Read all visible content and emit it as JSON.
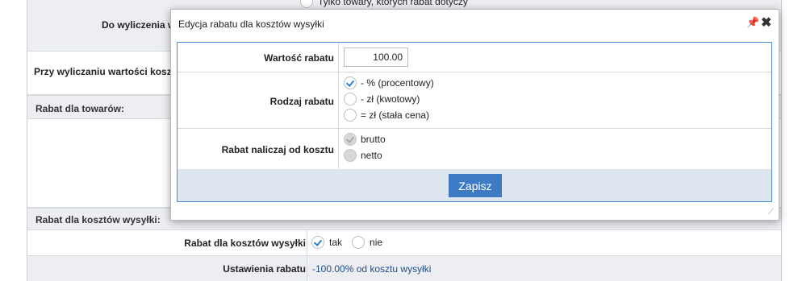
{
  "background": {
    "top_option": "Tylko towary, których rabat dotyczy",
    "row_do_wyliczenia": "Do wyliczenia w",
    "row_przy_wyliczaniu": "Przy wyliczaniu wartości kosz",
    "section_towary": "Rabat dla towarów:",
    "section_koszty": "Rabat dla kosztów wysyłki:",
    "rabat_koszty_label": "Rabat dla kosztów wysyłki",
    "rabat_koszty_tak": "tak",
    "rabat_koszty_nie": "nie",
    "ustawienia_label": "Ustawienia rabatu",
    "ustawienia_value": "-100.00% od kosztu wysyłki"
  },
  "dialog": {
    "title": "Edycja rabatu dla kosztów wysyłki",
    "wartosc_label": "Wartość rabatu",
    "wartosc_value": "100.00",
    "rodzaj_label": "Rodzaj rabatu",
    "rodzaj_options": [
      "- % (procentowy)",
      "- zł (kwotowy)",
      "= zł (stała cena)"
    ],
    "rodzaj_selected": 0,
    "naliczaj_label": "Rabat naliczaj od kosztu",
    "naliczaj_options": [
      "brutto",
      "netto"
    ],
    "naliczaj_selected": 0,
    "save_label": "Zapisz"
  },
  "icons": {
    "pin": "pin-icon",
    "close": "close-icon",
    "resize": "resize-grip-icon"
  },
  "colors": {
    "accent": "#3d7cc5",
    "dialog_border": "#4d8ed6",
    "link_text": "#1f4e8c",
    "section_bg": "#eceef1"
  }
}
